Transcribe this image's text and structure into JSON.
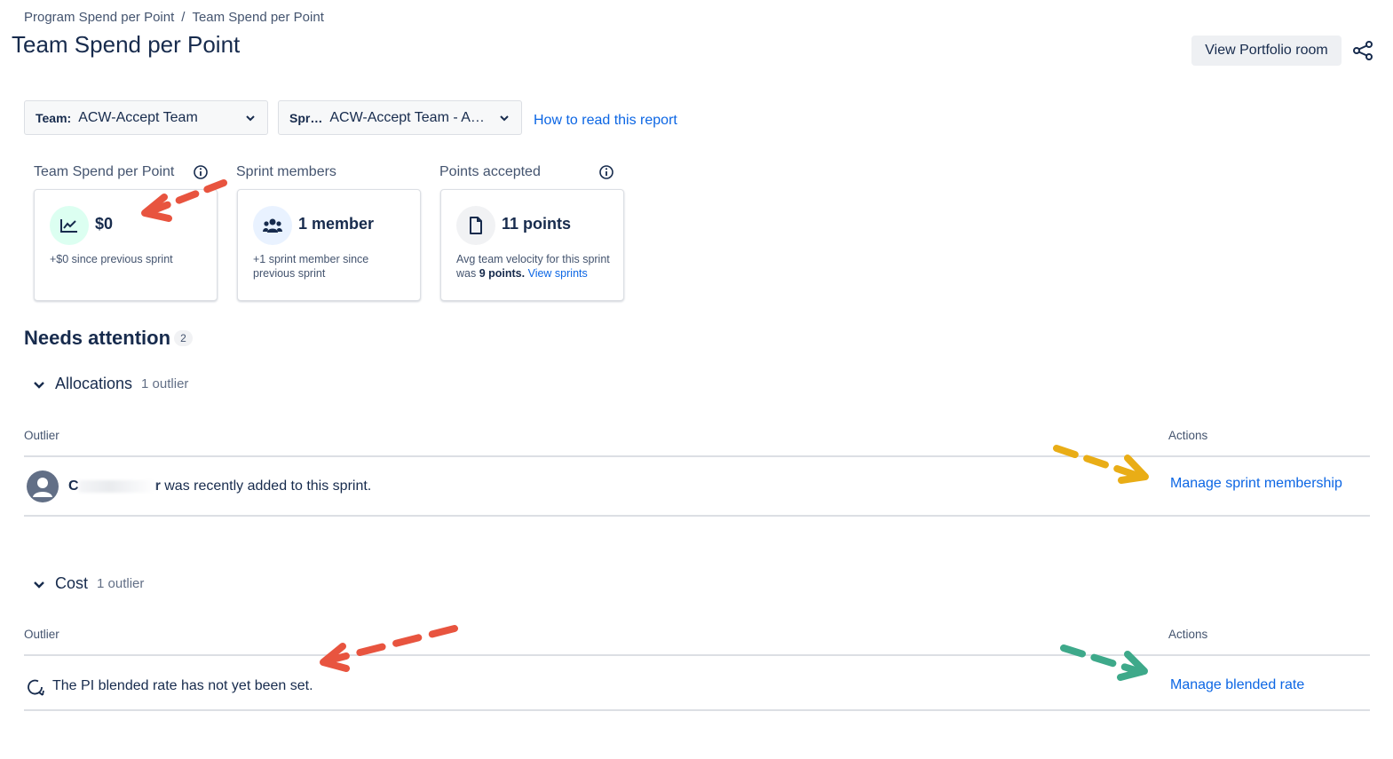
{
  "breadcrumb": {
    "items": [
      "Program Spend per Point",
      "Team Spend per Point"
    ],
    "separator": "/"
  },
  "page": {
    "title": "Team Spend per Point"
  },
  "header_actions": {
    "portfolio_button": "View Portfolio room",
    "share_icon": "share-icon"
  },
  "filters": {
    "team": {
      "label": "Team:",
      "value": "ACW-Accept Team"
    },
    "sprint": {
      "label": "Spr…",
      "value": "ACW-Accept Team - A…"
    },
    "help_link": "How to read this report"
  },
  "cards": [
    {
      "label": "Team Spend per Point",
      "value": "$0",
      "sub": "+$0 since previous sprint",
      "icon": "trend-chart-icon",
      "icon_bg": "#dcfff1"
    },
    {
      "label": "Sprint members",
      "value": "1 member",
      "sub": "+1 sprint member since previous sprint",
      "icon": "people-group-icon",
      "icon_bg": "#e9f2ff"
    },
    {
      "label": "Points accepted",
      "value": "11 points",
      "sub_pre": "Avg team velocity for this sprint was ",
      "sub_bold": "9 points.",
      "sub_link": "View sprints",
      "icon": "document-icon",
      "icon_bg": "#f1f2f4"
    }
  ],
  "needs_attention": {
    "title": "Needs attention",
    "count": "2"
  },
  "allocations": {
    "name": "Allocations",
    "count": "1 outlier",
    "col_outlier": "Outlier",
    "col_actions": "Actions",
    "row": {
      "name_start": "C",
      "name_end": "r",
      "text": " was recently added to this sprint.",
      "action": "Manage sprint membership"
    }
  },
  "cost": {
    "name": "Cost",
    "count": "1 outlier",
    "col_outlier": "Outlier",
    "col_actions": "Actions",
    "row": {
      "text": "The PI blended rate has not yet been set.",
      "action": "Manage blended rate"
    }
  },
  "annotation_colors": {
    "red": "#e8543f",
    "yellow": "#e9ad16",
    "green": "#3ea98a"
  },
  "colors": {
    "link": "#0c66e4",
    "text": "#172b4d",
    "subtle": "#44546f"
  }
}
